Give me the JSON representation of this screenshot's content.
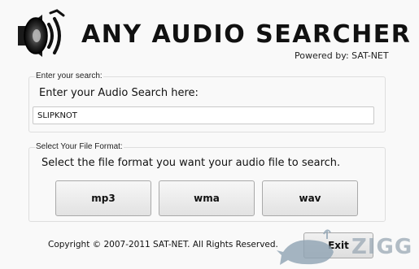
{
  "header": {
    "title": "ANY AUDIO SEARCHER",
    "powered_by": "Powered by: SAT-NET",
    "logo_icon": "speaker-with-sound-waves-icon"
  },
  "search_group": {
    "title": "Enter your search:",
    "prompt": "Enter your Audio Search here:",
    "input_value": "SLIPKNOT"
  },
  "format_group": {
    "title": "Select Your File Format:",
    "prompt": "Select the file format you want your audio file to search.",
    "buttons": [
      {
        "label": "mp3"
      },
      {
        "label": "wma"
      },
      {
        "label": "wav"
      }
    ]
  },
  "footer": {
    "copyright": "Copyright © 2007-2011 SAT-NET. All Rights Reserved.",
    "exit_label": "Exit"
  },
  "watermark": {
    "text": "ZIGG",
    "icon": "whale-icon"
  }
}
